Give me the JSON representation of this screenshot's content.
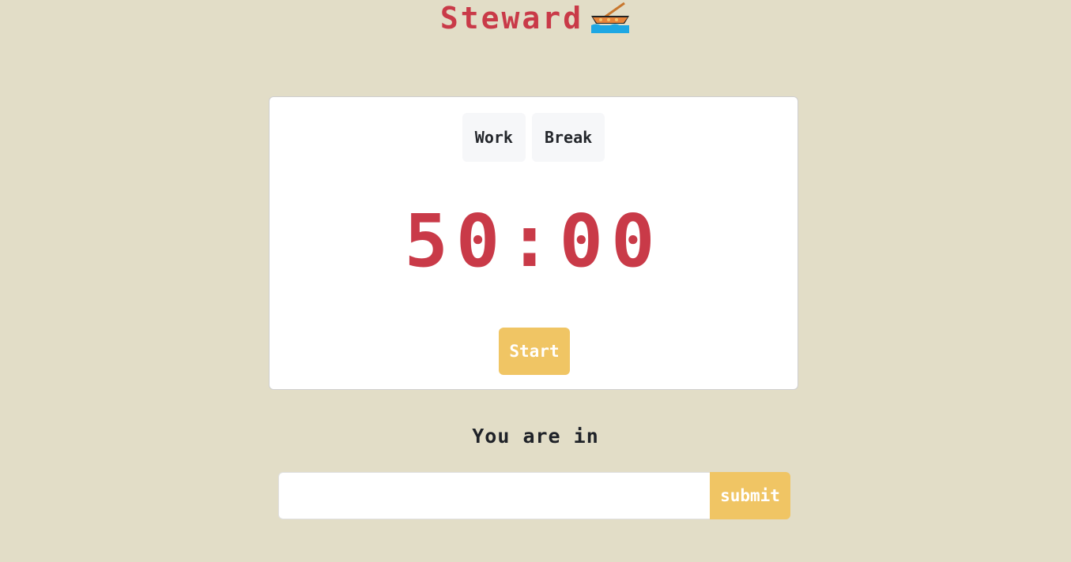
{
  "header": {
    "title": "Steward",
    "icon": "rowboat-icon"
  },
  "timer_card": {
    "tabs": [
      {
        "label": "Work"
      },
      {
        "label": "Break"
      }
    ],
    "time_display": "50:00",
    "start_label": "Start"
  },
  "status": {
    "text": "You are in"
  },
  "form": {
    "input_value": "",
    "input_placeholder": "",
    "submit_label": "submit"
  },
  "colors": {
    "background": "#e2ddc7",
    "accent_red": "#c93a48",
    "accent_yellow": "#f0c564"
  }
}
